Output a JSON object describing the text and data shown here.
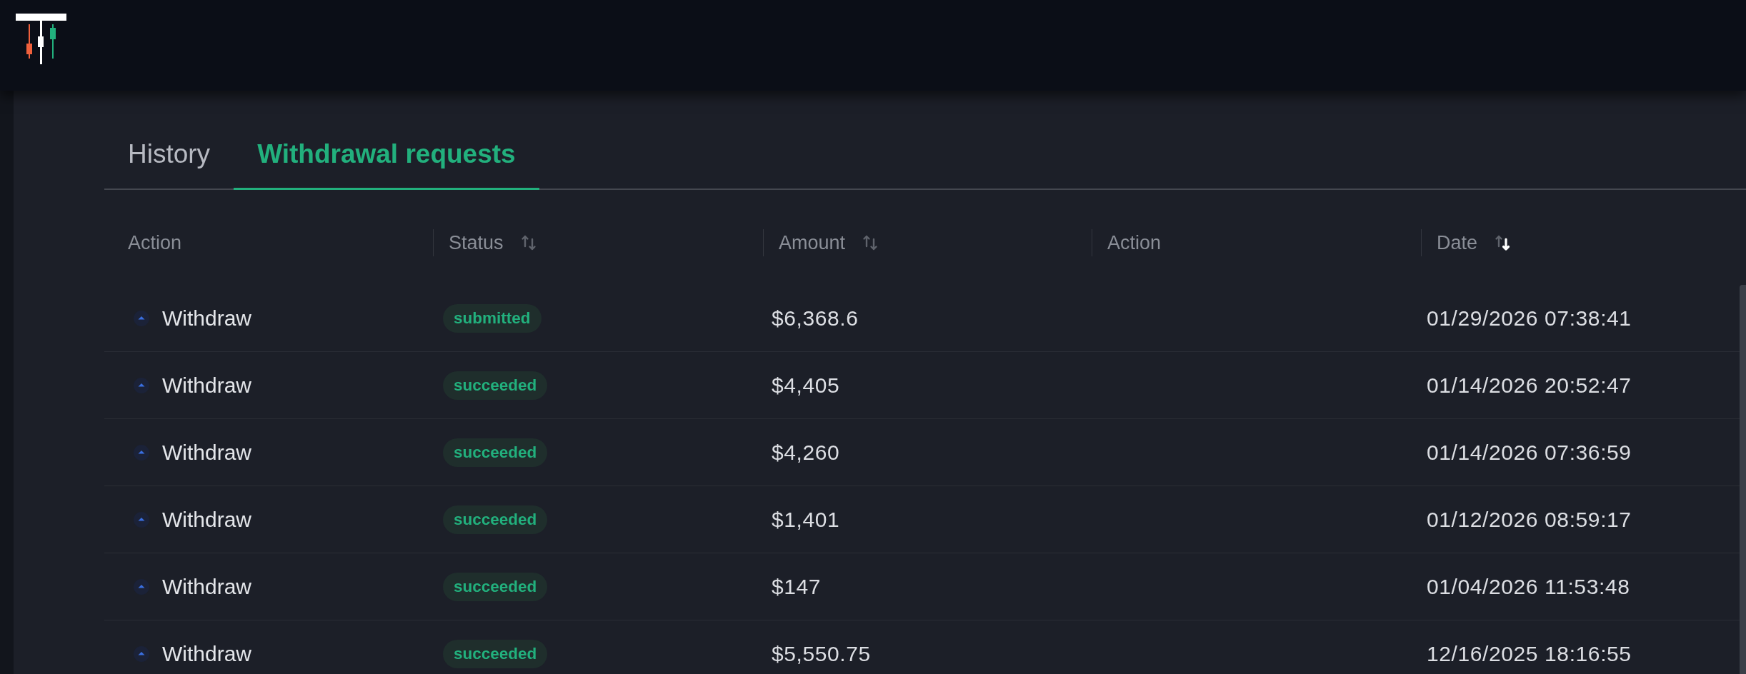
{
  "tabs": [
    {
      "label": "History",
      "selected": false
    },
    {
      "label": "Withdrawal requests",
      "selected": true
    }
  ],
  "table": {
    "columns": [
      {
        "label": "Action"
      },
      {
        "label": "Status",
        "sorted": false
      },
      {
        "label": "Amount",
        "sorted": false
      },
      {
        "label": "Action"
      },
      {
        "label": "Date",
        "sorted": true
      }
    ],
    "rows": [
      {
        "action": "Withdraw",
        "status": "submitted",
        "amount": "$6,368.6",
        "date": "01/29/2026 07:38:41"
      },
      {
        "action": "Withdraw",
        "status": "succeeded",
        "amount": "$4,405",
        "date": "01/14/2026 20:52:47"
      },
      {
        "action": "Withdraw",
        "status": "succeeded",
        "amount": "$4,260",
        "date": "01/14/2026 07:36:59"
      },
      {
        "action": "Withdraw",
        "status": "succeeded",
        "amount": "$1,401",
        "date": "01/12/2026 08:59:17"
      },
      {
        "action": "Withdraw",
        "status": "succeeded",
        "amount": "$147",
        "date": "01/04/2026 11:53:48"
      },
      {
        "action": "Withdraw",
        "status": "succeeded",
        "amount": "$5,550.75",
        "date": "12/16/2025 18:16:55"
      }
    ]
  }
}
